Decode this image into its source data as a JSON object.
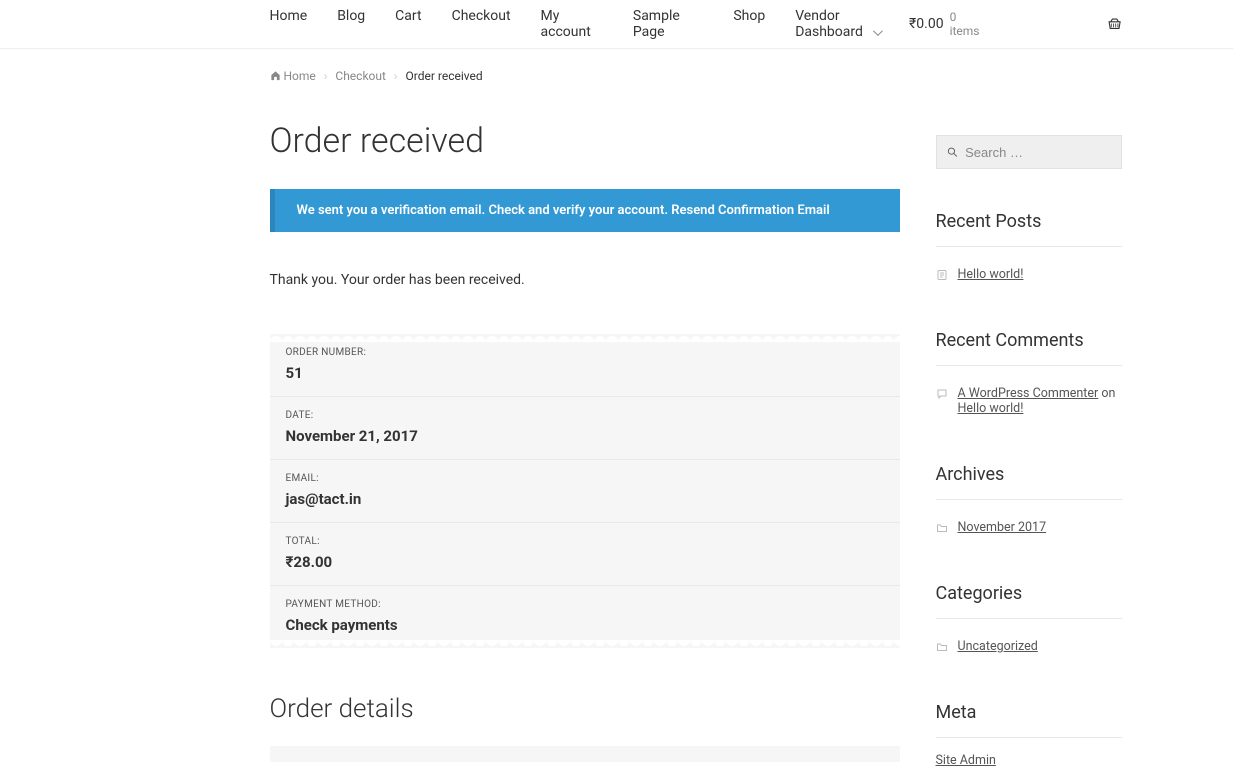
{
  "nav": {
    "items": [
      "Home",
      "Blog",
      "Cart",
      "Checkout",
      "My account",
      "Sample Page",
      "Shop",
      "Vendor Dashboard"
    ],
    "cart_total": "₹0.00",
    "cart_items": "0 items"
  },
  "breadcrumb": {
    "home": "Home",
    "checkout": "Checkout",
    "current": "Order received"
  },
  "page": {
    "title": "Order received",
    "notice_text": "We sent you a verification email. Check and verify your account. ",
    "notice_link": "Resend Confirmation Email",
    "thank_you": "Thank you. Your order has been received.",
    "details_title": "Order details"
  },
  "order": {
    "labels": {
      "number": "ORDER NUMBER:",
      "date": "DATE:",
      "email": "EMAIL:",
      "total": "TOTAL:",
      "payment": "PAYMENT METHOD:"
    },
    "number": "51",
    "date": "November 21, 2017",
    "email": "jas@tact.in",
    "total": "₹28.00",
    "payment": "Check payments"
  },
  "sidebar": {
    "search_placeholder": "Search …",
    "recent_posts": {
      "title": "Recent Posts",
      "items": [
        "Hello world!"
      ]
    },
    "recent_comments": {
      "title": "Recent Comments",
      "author": "A WordPress Commenter",
      "on": " on ",
      "post": "Hello world!"
    },
    "archives": {
      "title": "Archives",
      "items": [
        "November 2017"
      ]
    },
    "categories": {
      "title": "Categories",
      "items": [
        "Uncategorized"
      ]
    },
    "meta": {
      "title": "Meta",
      "items": [
        "Site Admin"
      ]
    }
  }
}
